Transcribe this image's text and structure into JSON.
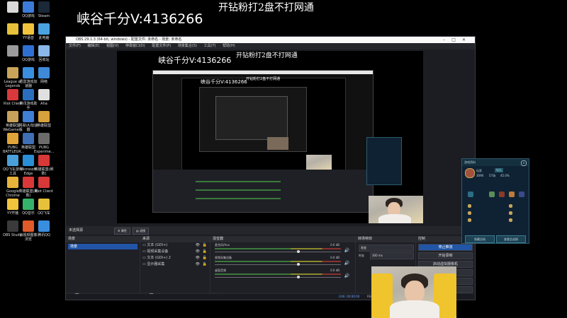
{
  "overlay": {
    "contact_text": "峡谷千分V:4136266",
    "promo_text": "开钻粉打2盘不打网通"
  },
  "desktop_icons": [
    {
      "label": "",
      "color": "#d9d9d9"
    },
    {
      "label": "QQ游戏",
      "color": "#3c7ad9"
    },
    {
      "label": "Steam",
      "color": "#1b2838"
    },
    {
      "label": "",
      "color": "#e8c13a"
    },
    {
      "label": "YY语音",
      "color": "#f1c33c"
    },
    {
      "label": "此电脑",
      "color": "#4aa3e0"
    },
    {
      "label": "",
      "color": "#9a9a9a"
    },
    {
      "label": "QQ游戏",
      "color": "#2f6fd1"
    },
    {
      "label": "回收站",
      "color": "#8ab8e8"
    },
    {
      "label": "League of Legends",
      "color": "#c9a55a"
    },
    {
      "label": "迅雷游戏加速器",
      "color": "#3a8ee0"
    },
    {
      "label": "网络",
      "color": "#3f8ad8"
    },
    {
      "label": "Riot Client",
      "color": "#d9393b"
    },
    {
      "label": "腾讯游戏助手",
      "color": "#2a6fbe"
    },
    {
      "label": "Aha",
      "color": "#e0e0e0"
    },
    {
      "label": "英雄联盟WeGame版",
      "color": "#c9a25a"
    },
    {
      "label": "网易UU加速器",
      "color": "#3f7fd6"
    },
    {
      "label": "英雄联盟",
      "color": "#d7a23c"
    },
    {
      "label": "PUBG BATTLEGR...",
      "color": "#e0a43a"
    },
    {
      "label": "英雄联盟",
      "color": "#3f6fb5"
    },
    {
      "label": "PUBG Experime...",
      "color": "#6b6b6b"
    },
    {
      "label": "QQ飞车游戏工具",
      "color": "#4aa0d8"
    },
    {
      "label": "Microsoft Edge",
      "color": "#2a8fd6"
    },
    {
      "label": "英雄联盟(刷数)",
      "color": "#d93838"
    },
    {
      "label": "Google Chrome",
      "color": "#e8b33a"
    },
    {
      "label": "英雄联盟(刷数)",
      "color": "#d93838"
    },
    {
      "label": "Riot Client",
      "color": "#d93838"
    },
    {
      "label": "YY开播",
      "color": "#f0c43c"
    },
    {
      "label": "QQ音乐",
      "color": "#35b26a"
    },
    {
      "label": "QQ飞车",
      "color": "#e8c13a"
    },
    {
      "label": "OBS Studio",
      "color": "#3a3a3a"
    },
    {
      "label": "云视频图像浏览",
      "color": "#e05a2a"
    },
    {
      "label": "腾讯QQ",
      "color": "#3a8ee0"
    }
  ],
  "obs": {
    "title": "OBS 29.1.3 (64-bit, windows) - 配置文件: 未命名 - 场景: 未命名",
    "menu": [
      "文件(F)",
      "编辑(E)",
      "视图(V)",
      "停靠窗口(D)",
      "配置文件(P)",
      "场景集合(S)",
      "工具(T)",
      "帮助(H)"
    ],
    "no_source_label": "未选择源",
    "properties_button": "属性",
    "filters_button": "滤镜",
    "docks": {
      "scenes": {
        "title": "场景",
        "items": [
          "场景"
        ]
      },
      "sources": {
        "title": "来源",
        "items": [
          "文本 (GDI+)",
          "视频采集设备",
          "文本 (GDI+) 2",
          "显示器采集"
        ]
      },
      "mixer": {
        "title": "混音器",
        "channels": [
          {
            "name": "麦克风/Aux",
            "db": "0.0 dB"
          },
          {
            "name": "视频采集设备",
            "db": "0.0 dB"
          },
          {
            "name": "桌面音频",
            "db": "0.0 dB"
          }
        ]
      },
      "transitions": {
        "title": "转场特效",
        "type": "渐变",
        "duration_label": "时长",
        "duration_value": "300 ms"
      },
      "controls": {
        "title": "控制",
        "buttons": [
          "停止推流",
          "开始录制",
          "启动虚拟摄像机",
          "工作室模式",
          "设置",
          "退出"
        ]
      }
    },
    "status": {
      "live": "LIVE: 00:00:00",
      "rec": "REC: 00:00:00",
      "cpu": "CPU: 2.5%",
      "fps": "60.00 fps"
    }
  },
  "lol_panel": {
    "title": "游戏资料",
    "player_name": "玩家",
    "rank_badge": "钻石",
    "stats": [
      "3090",
      "57场",
      "45.0%"
    ],
    "left_button": "隐藏总结",
    "right_button": "查看总战绩",
    "colors": {
      "bg": "#0f2233",
      "accent": "#3b7a90"
    }
  }
}
